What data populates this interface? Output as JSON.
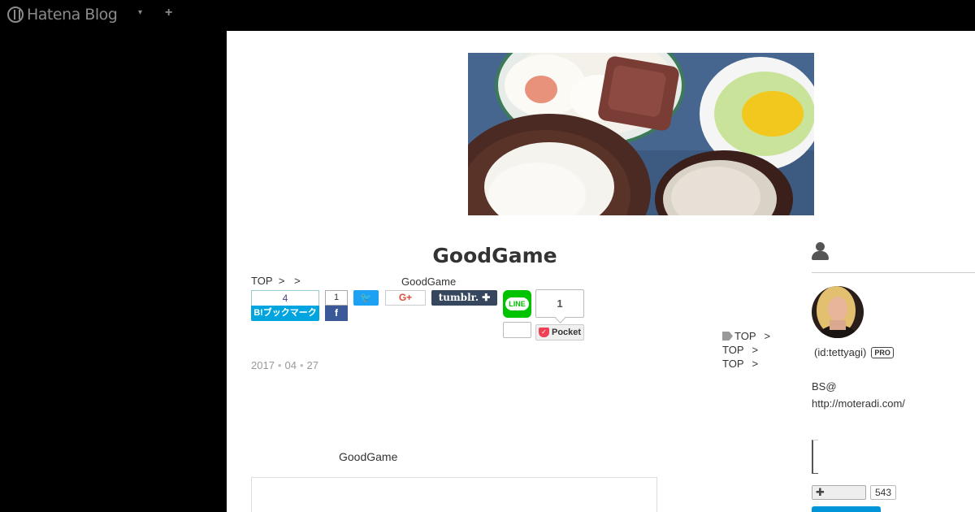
{
  "global_header": {
    "logo_text": "Hatena Blog",
    "menu_arrow": "▾",
    "add_symbol": "+"
  },
  "entry": {
    "title": "GoodGame",
    "breadcrumb": {
      "top": "TOP",
      "sep1": ">",
      "sep2": ">",
      "current": "GoodGame"
    },
    "date": {
      "year": "2017",
      "month": "04",
      "day": "27"
    },
    "subheading": "GoodGame"
  },
  "share": {
    "hatena_count": "4",
    "hatena_label": "B!ブックマーク",
    "facebook_count": "1",
    "facebook_label": "f",
    "twitter_label": "🐦",
    "gplus_label": "G+",
    "tumblr_label": "tumblr. ✚",
    "line_label": "LINE",
    "pocket_count": "1",
    "pocket_label": "Pocket"
  },
  "side_nav": [
    {
      "label": "TOP",
      "sep": ">",
      "has_tag": true
    },
    {
      "label": "TOP",
      "sep": ">",
      "has_tag": false
    },
    {
      "label": "TOP",
      "sep": ">",
      "has_tag": false
    }
  ],
  "profile": {
    "id_text": "(id:tettyagi)",
    "badge": "PRO",
    "desc_line1": "BS@",
    "desc_line2": "http://moteradi.com/",
    "subscribe_label": "✚",
    "subscriber_count": "543"
  },
  "colors": {
    "hatena": "#00a4de",
    "facebook": "#3b5998",
    "twitter": "#1da1f2",
    "tumblr": "#36465d",
    "line": "#00c300",
    "pocket": "#ef4056"
  }
}
